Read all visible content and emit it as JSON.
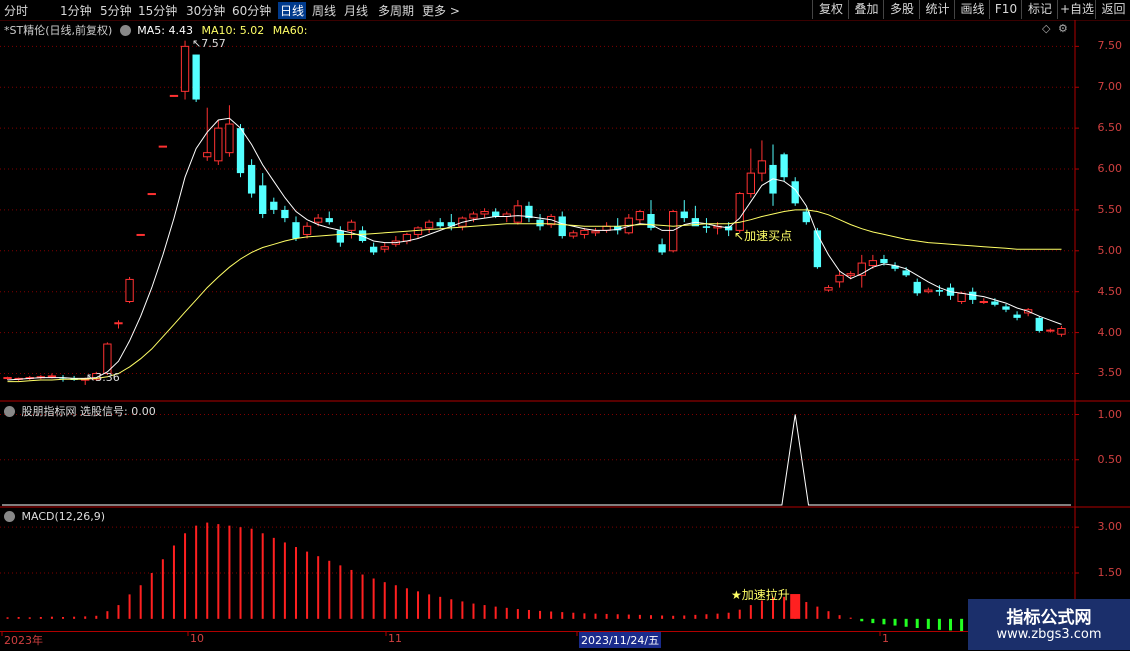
{
  "toolbar": {
    "periods": [
      "分时",
      "1分钟",
      "5分钟",
      "15分钟",
      "30分钟",
      "60分钟",
      "日线",
      "周线",
      "月线",
      "多周期",
      "更多 >"
    ],
    "active_period": "日线",
    "right_buttons": [
      "复权",
      "叠加",
      "多股",
      "统计",
      "画线",
      "F10",
      "标记",
      "+自选",
      "返回"
    ]
  },
  "main_panel": {
    "title": "*ST精伦(日线,前复权)",
    "ma5_label": "MA5: 4.43",
    "ma10_label": "MA10: 5.02",
    "ma60_label": "MA60:",
    "annotation_high": "7.57",
    "annotation_low": "3.36",
    "buy_point_label": "加速买点",
    "y_ticks": [
      "7.50",
      "7.00",
      "6.50",
      "6.00",
      "5.50",
      "5.00",
      "4.50",
      "4.00",
      "3.50"
    ]
  },
  "signal_panel": {
    "title": "股朋指标网 选股信号: 0.00",
    "y_ticks": [
      "1.00",
      "0.50"
    ]
  },
  "macd_panel": {
    "title": "MACD(12,26,9)",
    "label": "加速拉升",
    "y_ticks": [
      "3.00",
      "1.50"
    ]
  },
  "date_axis": {
    "labels": [
      "2023年",
      "10",
      "11",
      "2023/11/24/五",
      "1"
    ]
  },
  "watermark": {
    "line1": "指标公式网",
    "line2": "www.zbgs3.com"
  },
  "colors": {
    "up": "#ff3232",
    "down": "#54ffff",
    "ma5": "#ffffff",
    "ma10": "#ffff66",
    "macd_up": "#ff2020",
    "macd_down": "#22ff22",
    "grid": "#800000"
  },
  "chart_data": [
    {
      "type": "candlestick",
      "y_axis_label_ticks": [
        3.5,
        4.0,
        4.5,
        5.0,
        5.5,
        6.0,
        6.5,
        7.0,
        7.5
      ],
      "ylim": [
        3.2,
        7.7
      ],
      "candles": [
        [
          3.44,
          3.46,
          3.42,
          3.45
        ],
        [
          3.43,
          3.45,
          3.41,
          3.44
        ],
        [
          3.44,
          3.47,
          3.42,
          3.45
        ],
        [
          3.45,
          3.48,
          3.43,
          3.46
        ],
        [
          3.46,
          3.5,
          3.44,
          3.47
        ],
        [
          3.45,
          3.48,
          3.4,
          3.44
        ],
        [
          3.44,
          3.47,
          3.41,
          3.42
        ],
        [
          3.42,
          3.45,
          3.36,
          3.43
        ],
        [
          3.43,
          3.52,
          3.41,
          3.5
        ],
        [
          3.5,
          3.88,
          3.48,
          3.86
        ],
        [
          4.12,
          4.15,
          4.05,
          4.12
        ],
        [
          4.38,
          4.68,
          4.36,
          4.65
        ],
        [
          5.2,
          5.2,
          5.2,
          5.2
        ],
        [
          5.7,
          5.7,
          5.7,
          5.7
        ],
        [
          6.28,
          6.28,
          6.28,
          6.28
        ],
        [
          6.9,
          6.9,
          6.9,
          6.9
        ],
        [
          6.95,
          7.57,
          6.85,
          7.5
        ],
        [
          7.4,
          7.4,
          6.82,
          6.85
        ],
        [
          6.15,
          6.75,
          6.1,
          6.2
        ],
        [
          6.1,
          6.6,
          6.05,
          6.5
        ],
        [
          6.2,
          6.78,
          6.15,
          6.55
        ],
        [
          6.5,
          6.55,
          5.9,
          5.95
        ],
        [
          6.05,
          6.12,
          5.65,
          5.7
        ],
        [
          5.8,
          5.95,
          5.4,
          5.45
        ],
        [
          5.6,
          5.65,
          5.45,
          5.5
        ],
        [
          5.5,
          5.55,
          5.35,
          5.4
        ],
        [
          5.35,
          5.42,
          5.12,
          5.15
        ],
        [
          5.2,
          5.35,
          5.15,
          5.3
        ],
        [
          5.35,
          5.45,
          5.3,
          5.4
        ],
        [
          5.4,
          5.48,
          5.32,
          5.35
        ],
        [
          5.25,
          5.3,
          5.05,
          5.1
        ],
        [
          5.25,
          5.38,
          5.15,
          5.35
        ],
        [
          5.25,
          5.3,
          5.1,
          5.12
        ],
        [
          5.05,
          5.1,
          4.95,
          4.98
        ],
        [
          5.02,
          5.1,
          4.98,
          5.05
        ],
        [
          5.08,
          5.18,
          5.05,
          5.12
        ],
        [
          5.12,
          5.22,
          5.08,
          5.2
        ],
        [
          5.2,
          5.3,
          5.15,
          5.28
        ],
        [
          5.28,
          5.38,
          5.22,
          5.35
        ],
        [
          5.35,
          5.4,
          5.28,
          5.3
        ],
        [
          5.35,
          5.45,
          5.25,
          5.3
        ],
        [
          5.3,
          5.42,
          5.25,
          5.4
        ],
        [
          5.4,
          5.48,
          5.35,
          5.45
        ],
        [
          5.45,
          5.52,
          5.4,
          5.48
        ],
        [
          5.48,
          5.52,
          5.4,
          5.42
        ],
        [
          5.42,
          5.48,
          5.35,
          5.45
        ],
        [
          5.35,
          5.62,
          5.32,
          5.55
        ],
        [
          5.55,
          5.6,
          5.35,
          5.4
        ],
        [
          5.38,
          5.45,
          5.25,
          5.3
        ],
        [
          5.32,
          5.45,
          5.28,
          5.42
        ],
        [
          5.42,
          5.48,
          5.15,
          5.18
        ],
        [
          5.18,
          5.25,
          5.15,
          5.22
        ],
        [
          5.2,
          5.28,
          5.15,
          5.25
        ],
        [
          5.22,
          5.28,
          5.18,
          5.24
        ],
        [
          5.25,
          5.35,
          5.22,
          5.3
        ],
        [
          5.3,
          5.4,
          5.2,
          5.25
        ],
        [
          5.22,
          5.45,
          5.2,
          5.4
        ],
        [
          5.38,
          5.5,
          5.32,
          5.48
        ],
        [
          5.45,
          5.62,
          5.25,
          5.28
        ],
        [
          5.08,
          5.15,
          4.95,
          4.98
        ],
        [
          5.0,
          5.5,
          4.98,
          5.48
        ],
        [
          5.48,
          5.62,
          5.35,
          5.4
        ],
        [
          5.4,
          5.55,
          5.35,
          5.3
        ],
        [
          5.3,
          5.4,
          5.22,
          5.28
        ],
        [
          5.28,
          5.35,
          5.2,
          5.3
        ],
        [
          5.3,
          5.35,
          5.18,
          5.25
        ],
        [
          5.25,
          5.72,
          5.22,
          5.7
        ],
        [
          5.7,
          6.25,
          5.65,
          5.95
        ],
        [
          5.95,
          6.35,
          5.85,
          6.1
        ],
        [
          6.05,
          6.3,
          5.55,
          5.7
        ],
        [
          6.18,
          6.2,
          5.85,
          5.9
        ],
        [
          5.85,
          5.9,
          5.55,
          5.58
        ],
        [
          5.48,
          5.52,
          5.32,
          5.35
        ],
        [
          5.25,
          5.28,
          4.78,
          4.8
        ],
        [
          4.52,
          4.58,
          4.5,
          4.55
        ],
        [
          4.62,
          4.75,
          4.55,
          4.7
        ],
        [
          4.7,
          4.75,
          4.65,
          4.72
        ],
        [
          4.7,
          4.95,
          4.55,
          4.85
        ],
        [
          4.82,
          4.95,
          4.78,
          4.88
        ],
        [
          4.9,
          4.95,
          4.82,
          4.85
        ],
        [
          4.82,
          4.86,
          4.75,
          4.78
        ],
        [
          4.76,
          4.8,
          4.68,
          4.7
        ],
        [
          4.62,
          4.66,
          4.45,
          4.48
        ],
        [
          4.5,
          4.55,
          4.48,
          4.52
        ],
        [
          4.52,
          4.58,
          4.45,
          4.5
        ],
        [
          4.55,
          4.6,
          4.4,
          4.45
        ],
        [
          4.38,
          4.5,
          4.35,
          4.48
        ],
        [
          4.5,
          4.55,
          4.35,
          4.4
        ],
        [
          4.38,
          4.42,
          4.35,
          4.38
        ],
        [
          4.38,
          4.42,
          4.32,
          4.34
        ],
        [
          4.32,
          4.35,
          4.25,
          4.28
        ],
        [
          4.22,
          4.26,
          4.15,
          4.18
        ],
        [
          4.24,
          4.3,
          4.2,
          4.28
        ],
        [
          4.18,
          4.2,
          4.0,
          4.02
        ],
        [
          4.02,
          4.05,
          4.0,
          4.03
        ],
        [
          3.98,
          4.08,
          3.95,
          4.05
        ]
      ],
      "ma5": [
        3.42,
        3.43,
        3.44,
        3.45,
        3.45,
        3.45,
        3.44,
        3.44,
        3.45,
        3.52,
        3.65,
        3.9,
        4.2,
        4.55,
        4.95,
        5.4,
        5.9,
        6.25,
        6.45,
        6.6,
        6.62,
        6.5,
        6.3,
        6.05,
        5.85,
        5.65,
        5.48,
        5.38,
        5.32,
        5.28,
        5.25,
        5.22,
        5.18,
        5.12,
        5.1,
        5.1,
        5.12,
        5.15,
        5.2,
        5.25,
        5.3,
        5.35,
        5.38,
        5.4,
        5.42,
        5.42,
        5.43,
        5.42,
        5.4,
        5.38,
        5.33,
        5.3,
        5.27,
        5.25,
        5.25,
        5.26,
        5.3,
        5.33,
        5.32,
        5.25,
        5.25,
        5.32,
        5.35,
        5.33,
        5.3,
        5.28,
        5.4,
        5.6,
        5.8,
        5.88,
        5.85,
        5.75,
        5.55,
        5.2,
        4.95,
        4.75,
        4.66,
        4.72,
        4.8,
        4.84,
        4.82,
        4.78,
        4.7,
        4.62,
        4.55,
        4.5,
        4.48,
        4.46,
        4.44,
        4.4,
        4.36,
        4.3,
        4.26,
        4.2,
        4.15,
        4.1
      ],
      "ma10": [
        3.4,
        3.4,
        3.41,
        3.42,
        3.42,
        3.43,
        3.43,
        3.43,
        3.44,
        3.46,
        3.5,
        3.58,
        3.68,
        3.8,
        3.95,
        4.1,
        4.25,
        4.4,
        4.55,
        4.68,
        4.8,
        4.9,
        4.98,
        5.04,
        5.08,
        5.12,
        5.15,
        5.17,
        5.18,
        5.19,
        5.2,
        5.2,
        5.2,
        5.21,
        5.22,
        5.23,
        5.24,
        5.25,
        5.26,
        5.27,
        5.28,
        5.29,
        5.3,
        5.31,
        5.32,
        5.33,
        5.33,
        5.33,
        5.33,
        5.33,
        5.32,
        5.31,
        5.3,
        5.3,
        5.3,
        5.3,
        5.31,
        5.32,
        5.32,
        5.31,
        5.3,
        5.31,
        5.32,
        5.33,
        5.33,
        5.33,
        5.35,
        5.38,
        5.42,
        5.45,
        5.48,
        5.5,
        5.5,
        5.48,
        5.44,
        5.38,
        5.32,
        5.27,
        5.23,
        5.2,
        5.17,
        5.14,
        5.12,
        5.1,
        5.09,
        5.08,
        5.07,
        5.06,
        5.05,
        5.04,
        5.03,
        5.02,
        5.02,
        5.02,
        5.02,
        5.02
      ]
    },
    {
      "type": "line",
      "name": "选股信号",
      "ylim": [
        0,
        1.05
      ],
      "signal_index": 71,
      "values_note_index_signal": 1.0
    },
    {
      "type": "bar",
      "name": "MACD(12,26,9)",
      "ylim": [
        -0.3,
        3.3
      ],
      "values": [
        0.05,
        0.06,
        0.05,
        0.06,
        0.07,
        0.06,
        0.07,
        0.08,
        0.1,
        0.25,
        0.45,
        0.8,
        1.1,
        1.5,
        1.95,
        2.4,
        2.8,
        3.05,
        3.15,
        3.1,
        3.05,
        3.0,
        2.95,
        2.8,
        2.65,
        2.5,
        2.35,
        2.2,
        2.05,
        1.9,
        1.75,
        1.6,
        1.45,
        1.32,
        1.2,
        1.1,
        1.0,
        0.9,
        0.8,
        0.72,
        0.64,
        0.57,
        0.5,
        0.45,
        0.4,
        0.36,
        0.32,
        0.29,
        0.26,
        0.24,
        0.22,
        0.2,
        0.18,
        0.17,
        0.16,
        0.15,
        0.14,
        0.13,
        0.12,
        0.11,
        0.1,
        0.11,
        0.13,
        0.15,
        0.17,
        0.2,
        0.3,
        0.45,
        0.6,
        0.7,
        0.72,
        0.68,
        0.55,
        0.4,
        0.25,
        0.12,
        0.04,
        -0.08,
        -0.14,
        -0.18,
        -0.22,
        -0.26,
        -0.3,
        -0.33,
        -0.36,
        -0.38,
        -0.4,
        -0.42,
        -0.44,
        -0.46,
        -0.48,
        -0.5,
        -0.52,
        -0.54,
        -0.56,
        -0.58
      ],
      "highlight_index": 71
    }
  ]
}
